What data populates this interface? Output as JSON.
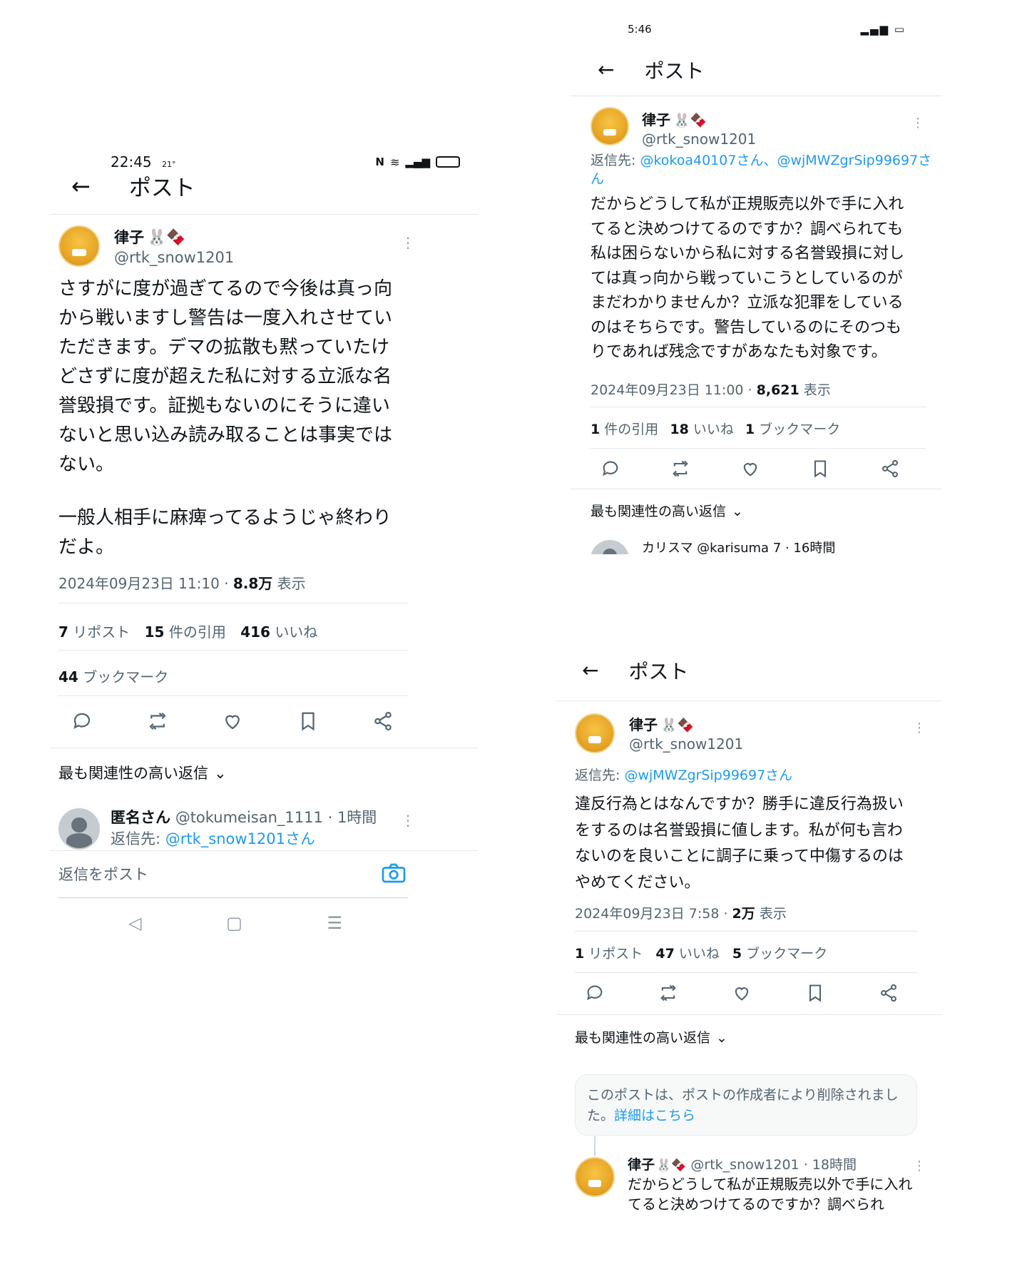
{
  "left": {
    "status": {
      "time": "22:45",
      "temp": "21°"
    },
    "header": {
      "back_icon": "arrow-left-icon",
      "title": "ポスト"
    },
    "post": {
      "name": "律子",
      "emoji": "🐰🍫",
      "handle": "@rtk_snow1201",
      "body": "さすがに度が過ぎてるので今後は真っ向から戦いますし警告は一度入れさせていただきます。デマの拡散も黙っていたけどさずに度が超えた私に対する立派な名誉毀損です。証拠もないのにそうに違いないと思い込み読み取ることは事実ではない。",
      "body2": "一般人相手に麻痺ってるようじゃ終わりだよ。",
      "datetime": "2024年09月23日 11:10",
      "views": "8.8万",
      "views_label": "表示",
      "reposts": "7",
      "reposts_label": "リポスト",
      "quotes": "15",
      "quotes_label": "件の引用",
      "likes": "416",
      "likes_label": "いいね",
      "bookmarks": "44",
      "bookmarks_label": "ブックマーク"
    },
    "reply_sort": "最も関連性の高い返信",
    "reply": {
      "name": "匿名さん",
      "handle": "@tokumeisan_1111",
      "time": "1時間",
      "replying_to_label": "返信先:",
      "replying_to": "@rtk_snow1201さん"
    },
    "composer": {
      "placeholder": "返信をポスト"
    }
  },
  "top_right": {
    "status": {
      "time": "5:46"
    },
    "header": {
      "title": "ポスト"
    },
    "post": {
      "name": "律子",
      "emoji": "🐰🍫",
      "handle": "@rtk_snow1201",
      "replying_to_label": "返信先:",
      "replying_to": "@kokoa40107さん、@wjMWZgrSip99697さん",
      "body": "だからどうして私が正規販売以外で手に入れてると決めつけてるのですか？調べられても私は困らないから私に対する名誉毀損に対しては真っ向から戦っていこうとしているのがまだわかりませんか？立派な犯罪をしているのはそちらです。警告しているのにそのつもりであれば残念ですがあなたも対象です。",
      "datetime": "2024年09月23日 11:00",
      "views": "8,621",
      "views_label": "表示",
      "quotes": "1",
      "quotes_label": "件の引用",
      "likes": "18",
      "likes_label": "いいね",
      "bookmarks": "1",
      "bookmarks_label": "ブックマーク"
    },
    "reply_sort": "最も関連性の高い返信",
    "reply_preview": "カリスマ @karisuma 7 · 16時間"
  },
  "bottom_right": {
    "header": {
      "title": "ポスト"
    },
    "post": {
      "name": "律子",
      "emoji": "🐰🍫",
      "handle": "@rtk_snow1201",
      "replying_to_label": "返信先:",
      "replying_to": "@wjMWZgrSip99697さん",
      "body": "違反行為とはなんですか？勝手に違反行為扱いをするのは名誉毀損に値します。私が何も言わないのを良いことに調子に乗って中傷するのはやめてください。",
      "datetime": "2024年09月23日 7:58",
      "views": "2万",
      "views_label": "表示",
      "reposts": "1",
      "reposts_label": "リポスト",
      "likes": "47",
      "likes_label": "いいね",
      "bookmarks": "5",
      "bookmarks_label": "ブックマーク"
    },
    "reply_sort": "最も関連性の高い返信",
    "deleted_notice": "このポストは、ポストの作成者により削除されました。",
    "deleted_link": "詳細はこちら",
    "thread_reply": {
      "name": "律子",
      "emoji": "🐰🍫",
      "handle": "@rtk_snow1201",
      "time": "18時間",
      "body": "だからどうして私が正規販売以外で手に入れてると決めつけてるのですか？調べられ"
    }
  },
  "colors": {
    "link": "#1d9bf0",
    "muted": "#536471",
    "text": "#0f1419"
  }
}
